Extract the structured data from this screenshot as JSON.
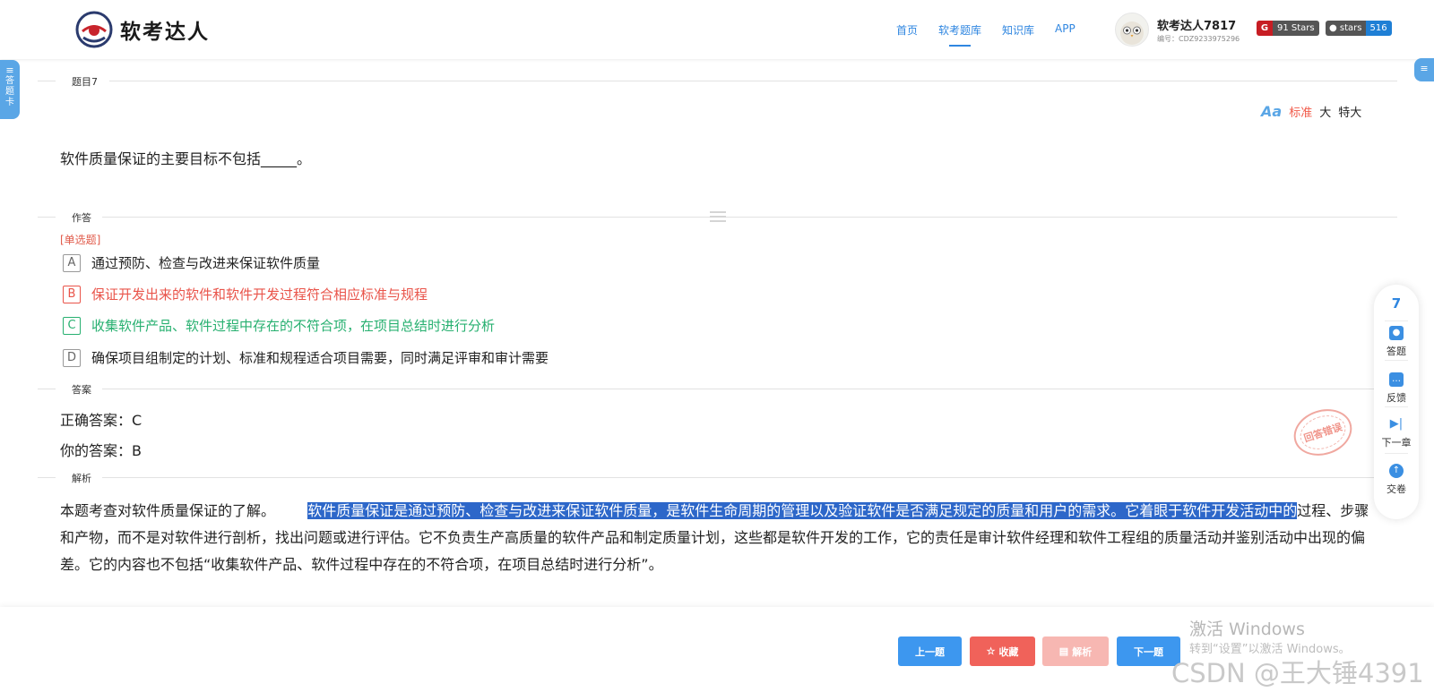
{
  "header": {
    "logo_text": "软考达人",
    "nav": [
      "首页",
      "软考题库",
      "知识库",
      "APP"
    ],
    "active_nav": "软考题库",
    "user": {
      "name": "软考达人7817",
      "id_label": "编号：CDZ9233975296"
    },
    "badges": {
      "gitee": {
        "icon": "gitee-icon",
        "text": "91 Stars"
      },
      "github": {
        "label": "stars",
        "count": "516"
      }
    }
  },
  "side": {
    "left_tab": [
      "答",
      "题",
      "卡"
    ],
    "left_tab_icon": "menu-icon",
    "right_tab_icon": "menu-icon"
  },
  "question_section": {
    "label": "题目7",
    "font_sizes": [
      "标准",
      "大",
      "特大"
    ],
    "active_font_size": "标准",
    "text": "软件质量保证的主要目标不包括_____。"
  },
  "answer_section": {
    "label": "作答",
    "type": "[单选题]",
    "options": [
      {
        "letter": "A",
        "text": "通过预防、检查与改进来保证软件质量",
        "state": "normal"
      },
      {
        "letter": "B",
        "text": "保证开发出来的软件和软件开发过程符合相应标准与规程",
        "state": "wrong"
      },
      {
        "letter": "C",
        "text": "收集软件产品、软件过程中存在的不符合项，在项目总结时进行分析",
        "state": "correct"
      },
      {
        "letter": "D",
        "text": "确保项目组制定的计划、标准和规程适合项目需要，同时满足评审和审计需要",
        "state": "normal"
      }
    ]
  },
  "result_section": {
    "label": "答案",
    "correct": "正确答案：C",
    "yours": "你的答案：B",
    "stamp": "回答错误"
  },
  "analysis_section": {
    "label": "解析",
    "intro": "本题考查对软件质量保证的了解。",
    "highlighted": "软件质量保证是通过预防、检查与改进来保证软件质量，是软件生命周期的管理以及验证软件是否满足规定的质量和用户的需求。它着眼于软件开发活动中的",
    "rest": "过程、步骤和产物，而不是对软件进行剖析，找出问题或进行评估。它不负责生产高质量的软件产品和制定质量计划，这些都是软件开发的工作，它的责任是审计软件经理和软件工程组的质量活动并鉴别活动中出现的偏差。它的内容也不包括“收集软件产品、软件过程中存在的不符合项，在项目总结时进行分析”。"
  },
  "float_panel": {
    "current": "7",
    "items": [
      {
        "label": "答题",
        "icon": "answer-icon"
      },
      {
        "label": "反馈",
        "icon": "feedback-icon"
      },
      {
        "label": "下一章",
        "icon": "next-chapter-icon"
      },
      {
        "label": "交卷",
        "icon": "submit-icon"
      }
    ]
  },
  "bottom": {
    "prev": "上一题",
    "favorite": "收藏",
    "analysis": "解析",
    "next": "下一题"
  },
  "watermarks": {
    "activate_title": "激活 Windows",
    "activate_sub": "转到“设置”以激活 Windows。",
    "csdn": "CSDN @王大锤4391"
  },
  "colors": {
    "primary": "#3d97ef",
    "wrong": "#e9544a",
    "correct": "#27b070",
    "highlight": "#2d67c9"
  }
}
